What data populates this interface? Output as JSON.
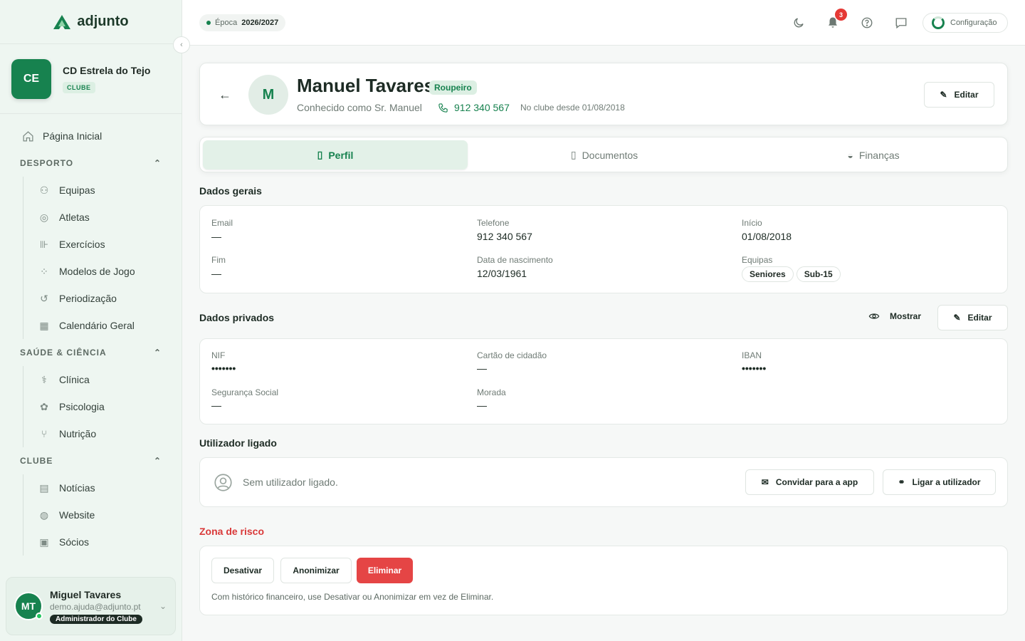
{
  "brand": {
    "name": "adjunto"
  },
  "club": {
    "initials": "CE",
    "name": "CD Estrela do Tejo",
    "tag": "CLUBE"
  },
  "nav": {
    "home": "Página Inicial",
    "sections": [
      {
        "title": "DESPORTO",
        "items": [
          "Equipas",
          "Atletas",
          "Exercícios",
          "Modelos de Jogo",
          "Periodização",
          "Calendário Geral"
        ]
      },
      {
        "title": "SAÚDE & CIÊNCIA",
        "items": [
          "Clínica",
          "Psicologia",
          "Nutrição"
        ]
      },
      {
        "title": "CLUBE",
        "items": [
          "Notícias",
          "Website",
          "Sócios"
        ]
      }
    ]
  },
  "user": {
    "initials": "MT",
    "name": "Miguel Tavares",
    "email": "demo.ajuda@adjunto.pt",
    "role": "Administrador do Clube"
  },
  "topbar": {
    "season_label": "Época",
    "season_value": "2026/2027",
    "notifications": "3",
    "config_label": "Configuração"
  },
  "person": {
    "initial": "M",
    "name": "Manuel Tavares",
    "role": "Roupeiro",
    "known_as": "Conhecido como Sr. Manuel",
    "phone": "912 340 567",
    "since": "No clube desde 01/08/2018",
    "edit_label": "Editar"
  },
  "tabs": [
    {
      "label": "Perfil",
      "active": true
    },
    {
      "label": "Documentos",
      "active": false
    },
    {
      "label": "Finanças",
      "active": false
    }
  ],
  "general": {
    "title": "Dados gerais",
    "email_label": "Email",
    "email_value": "—",
    "phone_label": "Telefone",
    "phone_value": "912 340 567",
    "start_label": "Início",
    "start_value": "01/08/2018",
    "end_label": "Fim",
    "end_value": "—",
    "birth_label": "Data de nascimento",
    "birth_value": "12/03/1961",
    "teams_label": "Equipas",
    "teams": [
      "Seniores",
      "Sub-15"
    ]
  },
  "private": {
    "title": "Dados privados",
    "show_label": "Mostrar",
    "edit_label": "Editar",
    "nif_label": "NIF",
    "nif_value": "•••••••",
    "cc_label": "Cartão de cidadão",
    "cc_value": "—",
    "iban_label": "IBAN",
    "iban_value": "•••••••",
    "ss_label": "Segurança Social",
    "ss_value": "—",
    "address_label": "Morada",
    "address_value": "—"
  },
  "linked": {
    "title": "Utilizador ligado",
    "empty_text": "Sem utilizador ligado.",
    "invite_label": "Convidar para a app",
    "link_label": "Ligar a utilizador"
  },
  "risk": {
    "title": "Zona de risco",
    "deactivate": "Desativar",
    "anonymize": "Anonimizar",
    "delete": "Eliminar",
    "note": "Com histórico financeiro, use Desativar ou Anonimizar em vez de Eliminar."
  },
  "colors": {
    "accent": "#17824f",
    "danger": "#e54545"
  }
}
